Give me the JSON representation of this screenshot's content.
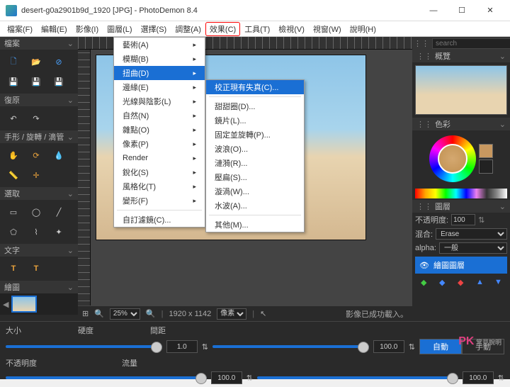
{
  "title": "desert-g0a2901b9d_1920 [JPG]  -  PhotoDemon 8.4",
  "menubar": [
    "檔案(F)",
    "編輯(E)",
    "影像(I)",
    "圖層(L)",
    "選擇(S)",
    "調整(A)",
    "效果(C)",
    "工具(T)",
    "檢視(V)",
    "視窗(W)",
    "說明(H)"
  ],
  "menubar_hl_index": 6,
  "panels": {
    "file": "檔案",
    "undo": "復原",
    "hand": "手形 / 旋轉 / 滴管",
    "select": "選取",
    "text": "文字",
    "draw": "繪圖"
  },
  "dropdown": [
    {
      "label": "藝術(A)",
      "sub": true
    },
    {
      "label": "模糊(B)",
      "sub": true
    },
    {
      "label": "扭曲(D)",
      "sub": true,
      "hl": true
    },
    {
      "label": "邊緣(E)",
      "sub": true
    },
    {
      "label": "光線與陰影(L)",
      "sub": true
    },
    {
      "label": "自然(N)",
      "sub": true
    },
    {
      "label": "雜點(O)",
      "sub": true
    },
    {
      "label": "像素(P)",
      "sub": true
    },
    {
      "label": "Render",
      "sub": true
    },
    {
      "label": "銳化(S)",
      "sub": true
    },
    {
      "label": "風格化(T)",
      "sub": true
    },
    {
      "label": "變形(F)",
      "sub": true
    },
    {
      "sep": true
    },
    {
      "label": "自訂濾鏡(C)...",
      "sub": false
    }
  ],
  "submenu": [
    {
      "label": "校正現有失真(C)...",
      "hl": true
    },
    {
      "sep": true
    },
    {
      "label": "甜甜圈(D)..."
    },
    {
      "label": "鏡片(L)..."
    },
    {
      "label": "固定並旋轉(P)..."
    },
    {
      "label": "波浪(O)..."
    },
    {
      "label": "漣漪(R)..."
    },
    {
      "label": "壓扁(S)..."
    },
    {
      "label": "漩渦(W)..."
    },
    {
      "label": "水波(A)..."
    },
    {
      "sep": true
    },
    {
      "label": "其他(M)..."
    }
  ],
  "right": {
    "search_ph": "search",
    "preview": "概覽",
    "color": "色彩",
    "layers": "圖層",
    "opacity_lbl": "不透明度:",
    "opacity_val": "100",
    "blend_lbl": "混合:",
    "blend_val": "Erase",
    "alpha_lbl": "alpha:",
    "alpha_val": "一般",
    "layer_name": "繪圖圖層"
  },
  "status": {
    "zoom": "25%",
    "dims": "1920 x 1142",
    "unit": "像素",
    "msg": "影像已成功載入。"
  },
  "bottom": {
    "size": "大小",
    "hardness": "硬度",
    "spacing": "間距",
    "opacity": "不透明度",
    "flow": "流量",
    "v1": "1.0",
    "v2": "100.0",
    "v3": "100.0",
    "v4": "100.0",
    "auto": "自動",
    "manual": "手動"
  }
}
